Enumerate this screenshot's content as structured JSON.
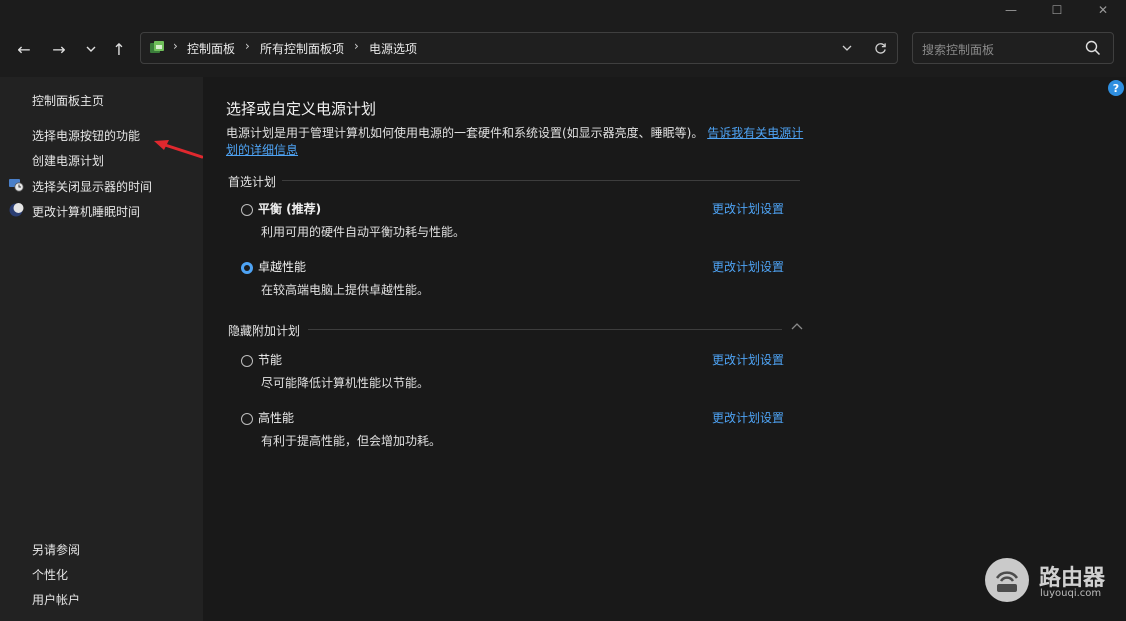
{
  "titlebar": {
    "minimize_glyph": "—",
    "maximize_glyph": "☐",
    "close_glyph": "✕"
  },
  "nav": {
    "back": "←",
    "forward": "→",
    "recent": "⌄",
    "up": "↑"
  },
  "address": {
    "crumbs": [
      "控制面板",
      "所有控制面板项",
      "电源选项"
    ],
    "separator": "›",
    "icon": "control-panel-icon"
  },
  "search": {
    "placeholder": "搜索控制面板"
  },
  "sidebar": {
    "home": "控制面板主页",
    "links": [
      "选择电源按钮的功能",
      "创建电源计划",
      "选择关闭显示器的时间",
      "更改计算机睡眠时间"
    ],
    "see_also": {
      "title": "另请参阅",
      "items": [
        "个性化",
        "用户帐户"
      ]
    }
  },
  "main": {
    "title": "选择或自定义电源计划",
    "description": "电源计划是用于管理计算机如何使用电源的一套硬件和系统设置(如显示器亮度、睡眠等)。",
    "description_link": "告诉我有关电源计划的详细信息",
    "preferred_group": "首选计划",
    "hidden_group": "隐藏附加计划",
    "change_link": "更改计划设置",
    "plans_preferred": [
      {
        "name": "平衡 (推荐)",
        "desc": "利用可用的硬件自动平衡功耗与性能。",
        "checked": false
      },
      {
        "name": "卓越性能",
        "desc": "在较高端电脑上提供卓越性能。",
        "checked": true
      }
    ],
    "plans_hidden": [
      {
        "name": "节能",
        "desc": "尽可能降低计算机性能以节能。",
        "checked": false
      },
      {
        "name": "高性能",
        "desc": "有利于提高性能，但会增加功耗。",
        "checked": false
      }
    ]
  },
  "help": {
    "glyph": "?"
  },
  "watermark": {
    "title": "路由器",
    "subtitle": "luyouqi.com"
  },
  "colors": {
    "link": "#4ea3f4",
    "background": "#191919",
    "sidebar": "#222222",
    "annotation_arrow": "#e0282e"
  }
}
